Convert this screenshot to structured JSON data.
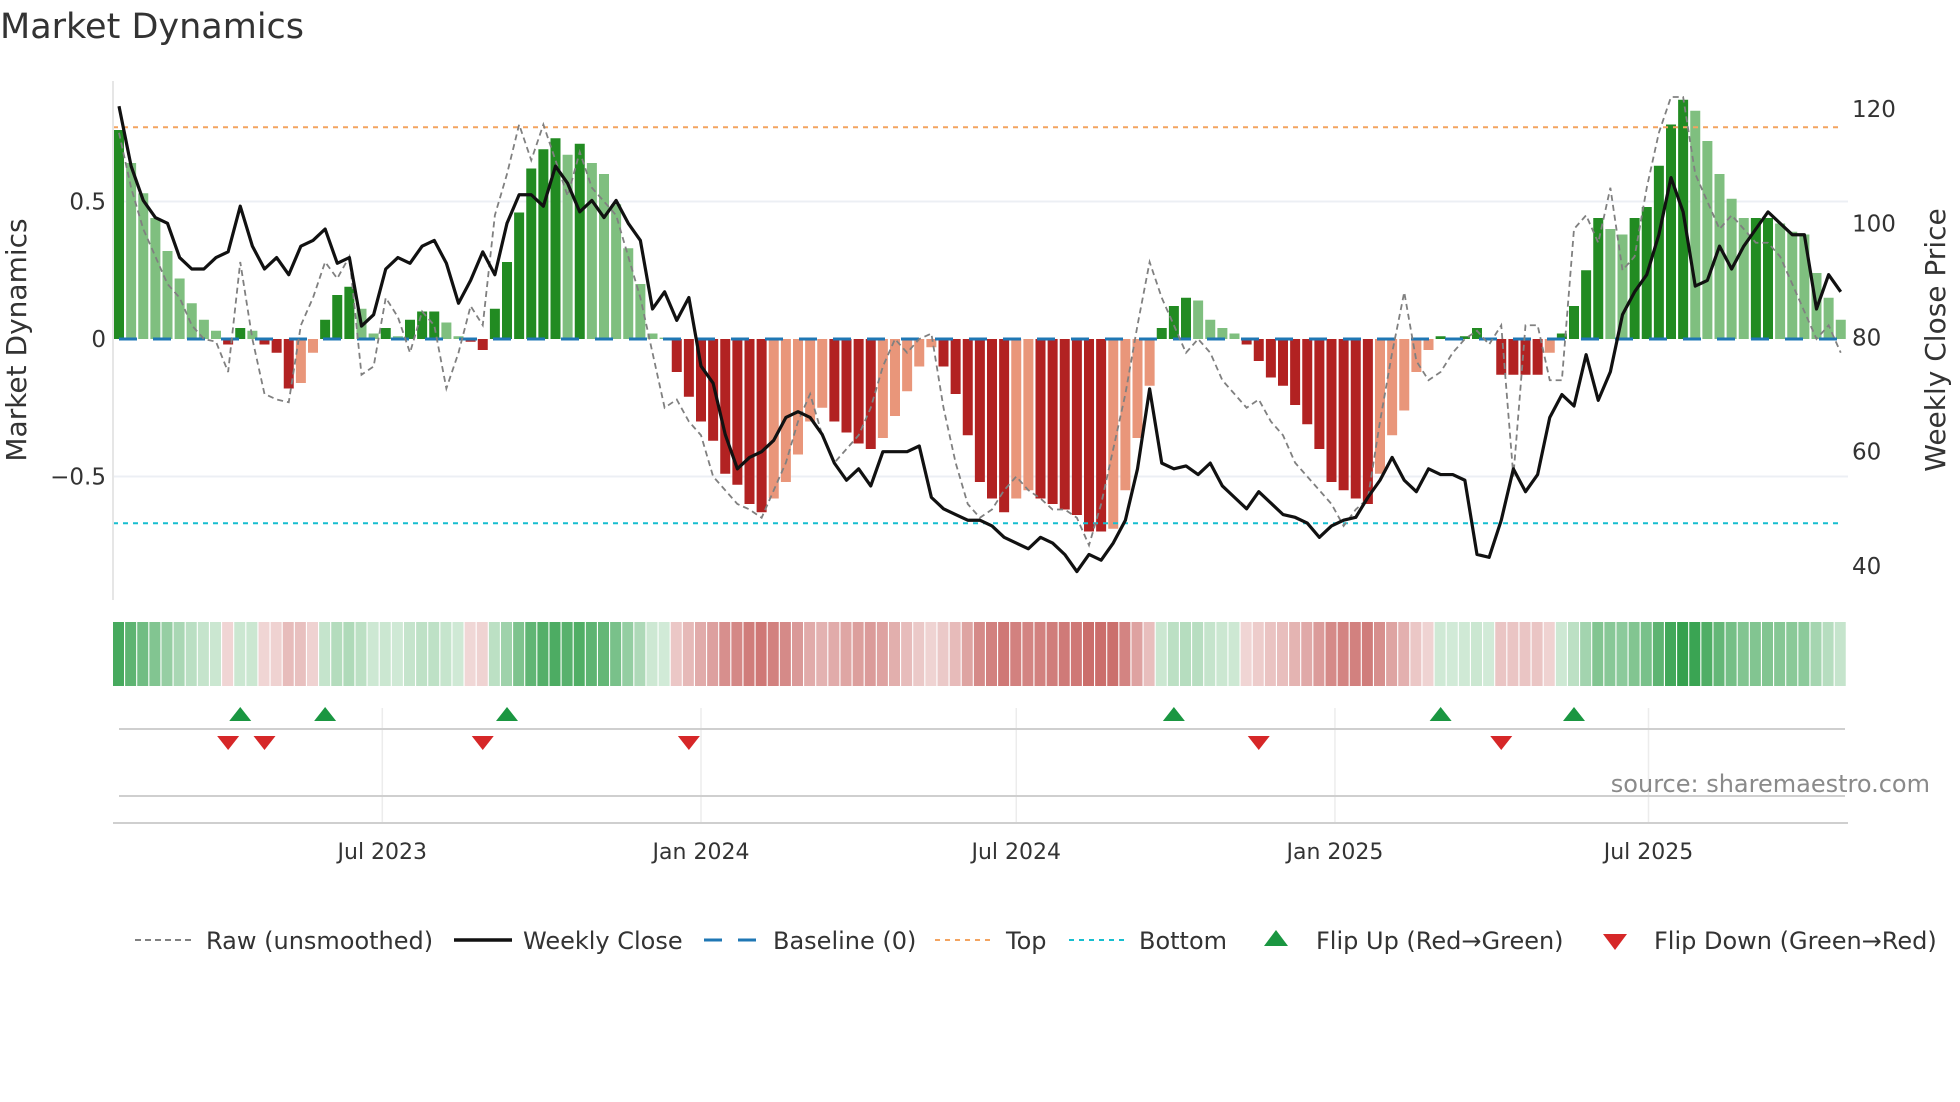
{
  "title": "Market Dynamics",
  "source": "source: sharemaestro.com",
  "chart_data": {
    "type": "bar",
    "title": "Market Dynamics",
    "ylabel": "Market Dynamics",
    "ylabel_right": "Weekly Close Price",
    "ylim": [
      -0.95,
      0.95
    ],
    "ylim_right": [
      35,
      125
    ],
    "yticks": [
      {
        "v": 0.5,
        "label": "0.5"
      },
      {
        "v": 0,
        "label": "0"
      },
      {
        "v": -0.5,
        "label": "−0.5"
      }
    ],
    "yticks_right": [
      {
        "v": 120,
        "label": "120"
      },
      {
        "v": 100,
        "label": "100"
      },
      {
        "v": 80,
        "label": "80"
      },
      {
        "v": 60,
        "label": "60"
      },
      {
        "v": 40,
        "label": "40"
      }
    ],
    "x_start": "2023-01-30",
    "x_step_days": 7,
    "x_ticks": [
      {
        "label": "Jul 2023",
        "date": "2023-07-01"
      },
      {
        "label": "Jan 2024",
        "date": "2024-01-01"
      },
      {
        "label": "Jul 2024",
        "date": "2024-07-01"
      },
      {
        "label": "Jan 2025",
        "date": "2025-01-01"
      },
      {
        "label": "Jul 2025",
        "date": "2025-07-01"
      }
    ],
    "top_level": 0.77,
    "bottom_level": -0.67,
    "baseline": 0,
    "momentum": [
      0.76,
      0.64,
      0.53,
      0.44,
      0.32,
      0.22,
      0.13,
      0.07,
      0.03,
      -0.02,
      0.04,
      0.03,
      -0.02,
      -0.05,
      -0.18,
      -0.16,
      -0.05,
      0.07,
      0.16,
      0.19,
      0.11,
      0.02,
      0.04,
      0.01,
      0.07,
      0.1,
      0.1,
      0.06,
      0.01,
      -0.01,
      -0.04,
      0.11,
      0.28,
      0.46,
      0.62,
      0.69,
      0.73,
      0.67,
      0.71,
      0.64,
      0.6,
      0.49,
      0.33,
      0.2,
      0.02,
      0.005,
      -0.12,
      -0.21,
      -0.3,
      -0.37,
      -0.49,
      -0.53,
      -0.6,
      -0.63,
      -0.58,
      -0.52,
      -0.42,
      -0.3,
      -0.25,
      -0.3,
      -0.34,
      -0.38,
      -0.4,
      -0.36,
      -0.28,
      -0.19,
      -0.1,
      -0.03,
      -0.1,
      -0.2,
      -0.35,
      -0.52,
      -0.58,
      -0.63,
      -0.58,
      -0.55,
      -0.58,
      -0.6,
      -0.62,
      -0.64,
      -0.7,
      -0.7,
      -0.69,
      -0.55,
      -0.36,
      -0.17,
      0.04,
      0.12,
      0.15,
      0.14,
      0.07,
      0.04,
      0.02,
      -0.02,
      -0.08,
      -0.14,
      -0.17,
      -0.24,
      -0.31,
      -0.4,
      -0.52,
      -0.55,
      -0.58,
      -0.6,
      -0.49,
      -0.35,
      -0.26,
      -0.12,
      -0.04,
      0.01,
      0.005,
      0.01,
      0.04,
      0.005,
      -0.13,
      -0.13,
      -0.13,
      -0.13,
      -0.05,
      0.02,
      0.12,
      0.25,
      0.44,
      0.4,
      0.38,
      0.44,
      0.48,
      0.63,
      0.78,
      0.87,
      0.83,
      0.72,
      0.6,
      0.51,
      0.44,
      0.44,
      0.44,
      0.42,
      0.39,
      0.38,
      0.24,
      0.15,
      0.07
    ],
    "raw": [
      0.75,
      0.55,
      0.4,
      0.3,
      0.2,
      0.15,
      0.05,
      0.0,
      -0.01,
      -0.12,
      0.28,
      0.0,
      -0.2,
      -0.22,
      -0.23,
      0.05,
      0.15,
      0.28,
      0.22,
      0.3,
      -0.13,
      -0.1,
      0.15,
      0.08,
      -0.05,
      0.1,
      0.05,
      -0.18,
      -0.05,
      0.12,
      0.05,
      0.45,
      0.6,
      0.78,
      0.65,
      0.78,
      0.65,
      0.52,
      0.68,
      0.55,
      0.5,
      0.45,
      0.3,
      0.15,
      -0.05,
      -0.25,
      -0.22,
      -0.3,
      -0.35,
      -0.5,
      -0.55,
      -0.6,
      -0.62,
      -0.65,
      -0.55,
      -0.45,
      -0.3,
      -0.2,
      -0.35,
      -0.45,
      -0.4,
      -0.35,
      -0.25,
      -0.1,
      0.0,
      -0.05,
      0.0,
      0.02,
      -0.25,
      -0.45,
      -0.6,
      -0.65,
      -0.62,
      -0.55,
      -0.5,
      -0.55,
      -0.58,
      -0.62,
      -0.62,
      -0.65,
      -0.75,
      -0.6,
      -0.4,
      -0.2,
      0.05,
      0.28,
      0.15,
      0.05,
      -0.05,
      0.0,
      -0.05,
      -0.15,
      -0.2,
      -0.25,
      -0.22,
      -0.3,
      -0.35,
      -0.45,
      -0.5,
      -0.55,
      -0.6,
      -0.68,
      -0.62,
      -0.58,
      -0.3,
      -0.05,
      0.17,
      -0.08,
      -0.15,
      -0.12,
      -0.05,
      0.0,
      0.03,
      -0.02,
      0.05,
      -0.5,
      0.05,
      0.05,
      -0.15,
      -0.15,
      0.4,
      0.45,
      0.35,
      0.55,
      0.25,
      0.3,
      0.55,
      0.75,
      0.88,
      0.88,
      0.6,
      0.5,
      0.4,
      0.45,
      0.4,
      0.35,
      0.35,
      0.3,
      0.2,
      0.1,
      0.0,
      0.05,
      -0.05
    ],
    "close": [
      120.5,
      110,
      104,
      101,
      100,
      94,
      92,
      92,
      94,
      95,
      103,
      96,
      92,
      94,
      91,
      96,
      97,
      99,
      93,
      94,
      82,
      84,
      92,
      94,
      93,
      96,
      97,
      93,
      86,
      90,
      95,
      91,
      100,
      105,
      105,
      103,
      110,
      107,
      102,
      104,
      101,
      104,
      100,
      97,
      85,
      88,
      83,
      87,
      75,
      72,
      63,
      57,
      59,
      60,
      62,
      66,
      67,
      66,
      63,
      58,
      55,
      57,
      54,
      60,
      60,
      60,
      61,
      52,
      50,
      49,
      48,
      48,
      47,
      45,
      44,
      43,
      45,
      44,
      42,
      39,
      42,
      41,
      44,
      48,
      57,
      71,
      58,
      57,
      57.5,
      56,
      58,
      54,
      52,
      50,
      53,
      51,
      49,
      48.5,
      47.5,
      45,
      47,
      48,
      48.5,
      52,
      55,
      59,
      55,
      53,
      57,
      56,
      56,
      55,
      42,
      41.5,
      48,
      57,
      53,
      56,
      66,
      70,
      68,
      77,
      69,
      74,
      84,
      88,
      91,
      98,
      108,
      102,
      89,
      90,
      96,
      92,
      96,
      99,
      102,
      100,
      98,
      98,
      85,
      91,
      88
    ],
    "flip_up_weeks": [
      10,
      17,
      32,
      87,
      109,
      120
    ],
    "flip_down_weeks": [
      9,
      12,
      30,
      47,
      94,
      114
    ],
    "legend": [
      {
        "key": "raw",
        "label": "Raw (unsmoothed)"
      },
      {
        "key": "close",
        "label": "Weekly Close"
      },
      {
        "key": "baseline",
        "label": "Baseline (0)"
      },
      {
        "key": "top",
        "label": "Top"
      },
      {
        "key": "bottom",
        "label": "Bottom"
      },
      {
        "key": "flip_up",
        "label": "Flip Up (Red→Green)"
      },
      {
        "key": "flip_down",
        "label": "Flip Down (Green→Red)"
      }
    ],
    "legend_position": "bottom",
    "colors": {
      "up_strong": "#228b22",
      "up_weak": "#7fbf7f",
      "down_strong": "#b22222",
      "down_weak": "#e9967a",
      "raw": "#808080",
      "close": "#111111",
      "baseline": "#1f77b4",
      "top": "#f4a460",
      "bottom": "#17becf",
      "flip_up": "#1a9641",
      "flip_down": "#d62728",
      "strip_green": "#2e9e48",
      "strip_red": "#c0504d"
    }
  }
}
